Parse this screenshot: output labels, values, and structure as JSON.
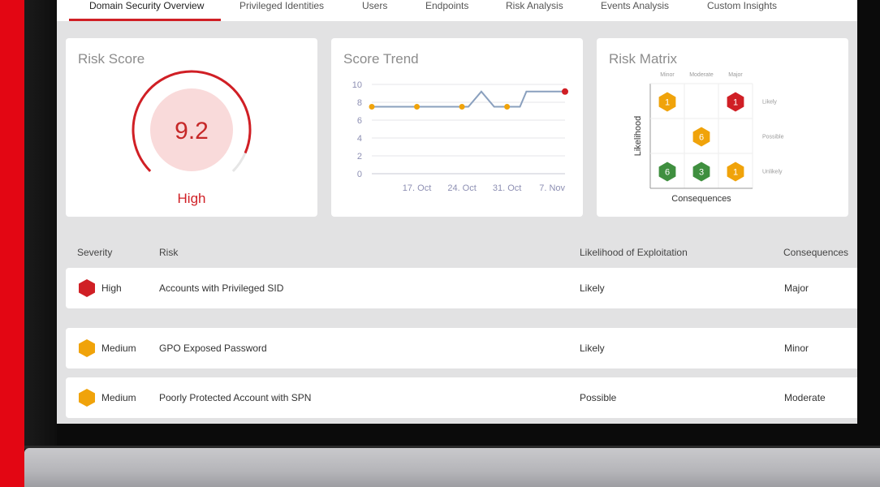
{
  "tabs": [
    {
      "label": "Domain Security Overview",
      "active": true
    },
    {
      "label": "Privileged Identities",
      "active": false
    },
    {
      "label": "Users",
      "active": false
    },
    {
      "label": "Endpoints",
      "active": false
    },
    {
      "label": "Risk Analysis",
      "active": false
    },
    {
      "label": "Events Analysis",
      "active": false
    },
    {
      "label": "Custom Insights",
      "active": false
    }
  ],
  "risk_score": {
    "title": "Risk Score",
    "value": "9.2",
    "level": "High",
    "max": 10,
    "colors": {
      "accent": "#d01f25",
      "fill": "#f9dada",
      "track": "#e6e6e6"
    }
  },
  "score_trend": {
    "title": "Score Trend"
  },
  "chart_data": {
    "type": "line",
    "title": "Score Trend",
    "xlabel": "",
    "ylabel": "",
    "ylim": [
      0,
      10
    ],
    "yticks": [
      "0",
      "2",
      "4",
      "6",
      "8",
      "10"
    ],
    "xticks": [
      "17. Oct",
      "24. Oct",
      "31. Oct",
      "7. Nov"
    ],
    "grid": true,
    "series": [
      {
        "color": "#8aa0be",
        "points": [
          {
            "x": "2018-10-10",
            "y": 7.5,
            "marker": "#f0a30a"
          },
          {
            "x": "2018-10-17",
            "y": 7.5,
            "marker": "#f0a30a"
          },
          {
            "x": "2018-10-24",
            "y": 7.5,
            "marker": "#f0a30a"
          },
          {
            "x": "2018-10-25",
            "y": 7.5
          },
          {
            "x": "2018-10-27",
            "y": 9.2
          },
          {
            "x": "2018-10-29",
            "y": 7.5
          },
          {
            "x": "2018-10-31",
            "y": 7.5,
            "marker": "#f0a30a"
          },
          {
            "x": "2018-11-02",
            "y": 7.5
          },
          {
            "x": "2018-11-03",
            "y": 9.2
          },
          {
            "x": "2018-11-09",
            "y": 9.2,
            "marker": "#d01f25"
          }
        ]
      }
    ]
  },
  "risk_matrix": {
    "title": "Risk Matrix",
    "columns": [
      "Minor",
      "Moderate",
      "Major"
    ],
    "rows": [
      "Likely",
      "Possible",
      "Unlikely"
    ],
    "ylabel": "Likelihood",
    "xlabel": "Consequences",
    "cells": [
      {
        "row": 0,
        "col": 0,
        "count": "1",
        "color": "#f0a30a"
      },
      {
        "row": 0,
        "col": 2,
        "count": "1",
        "color": "#d01f25"
      },
      {
        "row": 1,
        "col": 1,
        "count": "6",
        "color": "#f0a30a"
      },
      {
        "row": 2,
        "col": 0,
        "count": "6",
        "color": "#3f8f3f"
      },
      {
        "row": 2,
        "col": 1,
        "count": "3",
        "color": "#3f8f3f"
      },
      {
        "row": 2,
        "col": 2,
        "count": "1",
        "color": "#f0a30a"
      }
    ]
  },
  "table": {
    "headers": {
      "severity": "Severity",
      "risk": "Risk",
      "likelihood": "Likelihood of Exploitation",
      "consequences": "Consequences"
    },
    "rows": [
      {
        "severity": "High",
        "severity_color": "#d01f25",
        "risk": "Accounts with Privileged SID",
        "likelihood": "Likely",
        "consequences": "Major"
      },
      {
        "severity": "Medium",
        "severity_color": "#f0a30a",
        "risk": "GPO Exposed Password",
        "likelihood": "Likely",
        "consequences": "Minor"
      },
      {
        "severity": "Medium",
        "severity_color": "#f0a30a",
        "risk": "Poorly Protected Account with SPN",
        "likelihood": "Possible",
        "consequences": "Moderate"
      }
    ]
  }
}
